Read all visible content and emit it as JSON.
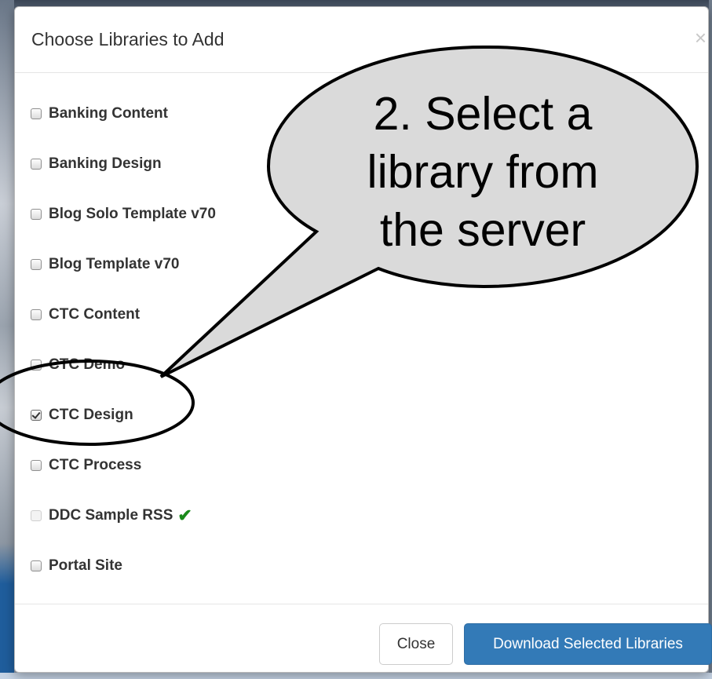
{
  "dialog": {
    "title": "Choose Libraries to Add",
    "close_symbol": "×"
  },
  "libraries": [
    {
      "label": "Banking Content",
      "checked": false,
      "disabled": false
    },
    {
      "label": "Banking Design",
      "checked": false,
      "disabled": false
    },
    {
      "label": "Blog Solo Template v70",
      "checked": false,
      "disabled": false
    },
    {
      "label": "Blog Template v70",
      "checked": false,
      "disabled": false
    },
    {
      "label": "CTC Content",
      "checked": false,
      "disabled": false
    },
    {
      "label": "CTC Demo",
      "checked": false,
      "disabled": false
    },
    {
      "label": "CTC Design",
      "checked": true,
      "disabled": false
    },
    {
      "label": "CTC Process",
      "checked": false,
      "disabled": false
    },
    {
      "label": "DDC Sample RSS",
      "checked": false,
      "disabled": true,
      "downloaded_mark": "✔"
    },
    {
      "label": "Portal Site",
      "checked": false,
      "disabled": false
    }
  ],
  "footer": {
    "close_label": "Close",
    "download_label": "Download Selected Libraries"
  },
  "callout": {
    "lines": [
      "2. Select a",
      "library from",
      "the server"
    ]
  },
  "colors": {
    "primary_button": "#337ab7",
    "check_mark": "#1a8a1a"
  },
  "icons": {
    "close": "close-icon",
    "downloaded": "checkmark-icon"
  }
}
